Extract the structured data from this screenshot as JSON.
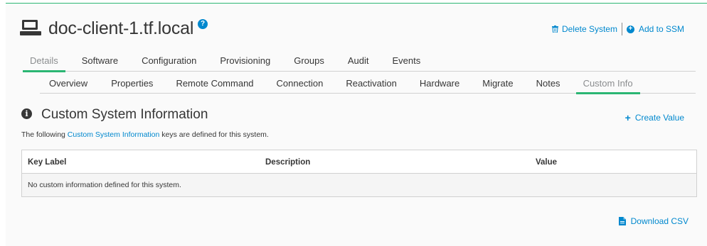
{
  "header": {
    "system_name": "doc-client-1.tf.local",
    "help_glyph": "?",
    "delete_label": "Delete System",
    "ssm_label": "Add to SSM"
  },
  "main_tabs": [
    {
      "label": "Details",
      "active": true
    },
    {
      "label": "Software",
      "active": false
    },
    {
      "label": "Configuration",
      "active": false
    },
    {
      "label": "Provisioning",
      "active": false
    },
    {
      "label": "Groups",
      "active": false
    },
    {
      "label": "Audit",
      "active": false
    },
    {
      "label": "Events",
      "active": false
    }
  ],
  "sub_tabs": [
    {
      "label": "Overview",
      "active": false
    },
    {
      "label": "Properties",
      "active": false
    },
    {
      "label": "Remote Command",
      "active": false
    },
    {
      "label": "Connection",
      "active": false
    },
    {
      "label": "Reactivation",
      "active": false
    },
    {
      "label": "Hardware",
      "active": false
    },
    {
      "label": "Migrate",
      "active": false
    },
    {
      "label": "Notes",
      "active": false
    },
    {
      "label": "Custom Info",
      "active": true
    }
  ],
  "section": {
    "title": "Custom System Information",
    "create_label": "Create Value",
    "intro_prefix": "The following ",
    "intro_link": "Custom System Information",
    "intro_suffix": " keys are defined for this system."
  },
  "table": {
    "columns": [
      "Key Label",
      "Description",
      "Value"
    ],
    "empty_message": "No custom information defined for this system."
  },
  "download_label": "Download CSV",
  "colors": {
    "accent_green": "#2bb673",
    "link_blue": "#0088ce",
    "text": "#363636"
  }
}
